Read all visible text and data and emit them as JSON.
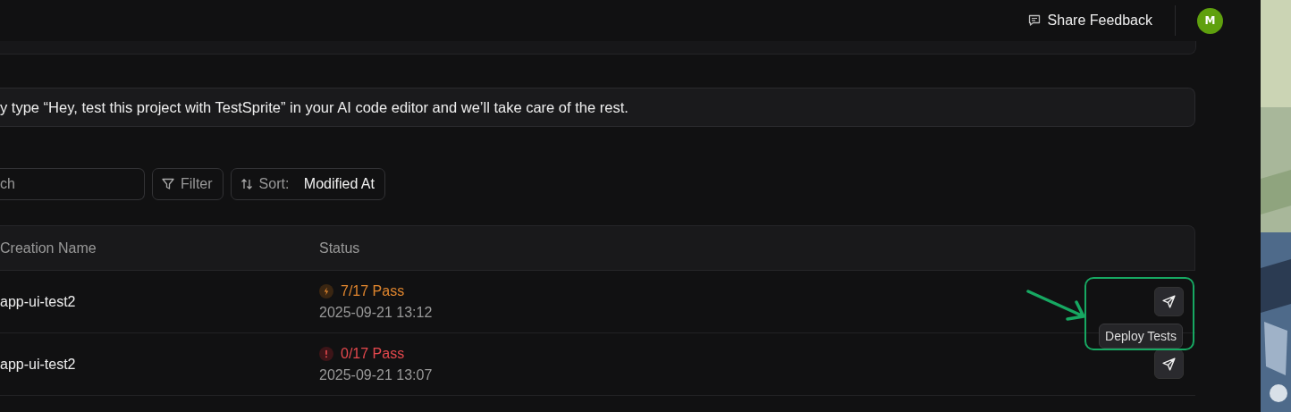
{
  "header": {
    "feedback_button": "Share Feedback",
    "avatar": "M"
  },
  "banner": {
    "text": "y type “Hey, test this project with TestSprite” in your AI code editor and we’ll take care of the rest."
  },
  "toolbar": {
    "search": {
      "placeholder": "ch"
    },
    "filter_button": "Filter",
    "sort": {
      "label": "Sort:",
      "value": "Modified At"
    }
  },
  "table": {
    "columns": [
      "Creation Name",
      "Status"
    ],
    "rows": [
      {
        "name": "app-ui-test2",
        "status": {
          "kind": "partial",
          "text": "7/17 Pass"
        },
        "date": "2025-09-21 13:12"
      },
      {
        "name": "app-ui-test2",
        "status": {
          "kind": "failed",
          "text": "0/17 Pass"
        },
        "date": "2025-09-21 13:07"
      }
    ]
  },
  "tooltip": "Deploy Tests"
}
